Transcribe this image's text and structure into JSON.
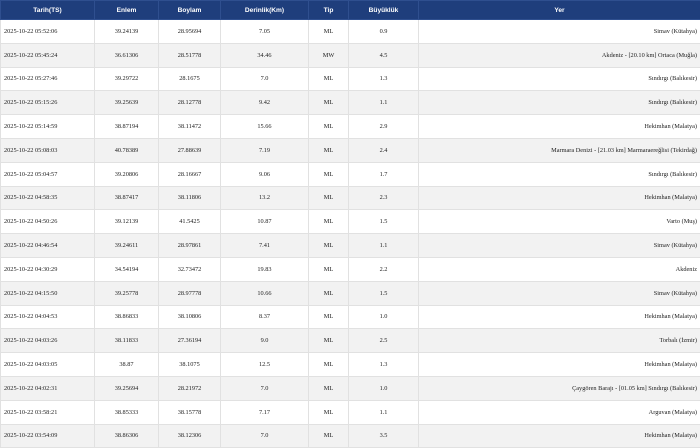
{
  "table": {
    "headers": [
      "Tarih(TS)",
      "Enlem",
      "Boylam",
      "Derinlik(Km)",
      "Tip",
      "Büyüklük",
      "Yer"
    ],
    "rows": [
      [
        "2025-10-22 05:52:06",
        "39.24139",
        "28.95694",
        "7.05",
        "ML",
        "0.9",
        "Simav (Kütahya)"
      ],
      [
        "2025-10-22 05:45:24",
        "36.61306",
        "28.51778",
        "34.46",
        "MW",
        "4.5",
        "Akdeniz - [20.10 km] Ortaca (Muğla)"
      ],
      [
        "2025-10-22 05:27:46",
        "39.29722",
        "28.1675",
        "7.0",
        "ML",
        "1.3",
        "Sındırgı (Balıkesir)"
      ],
      [
        "2025-10-22 05:15:26",
        "39.25639",
        "28.12778",
        "9.42",
        "ML",
        "1.1",
        "Sındırgı (Balıkesir)"
      ],
      [
        "2025-10-22 05:14:59",
        "38.87194",
        "38.11472",
        "15.66",
        "ML",
        "2.9",
        "Hekimhan (Malatya)"
      ],
      [
        "2025-10-22 05:08:03",
        "40.78389",
        "27.88639",
        "7.19",
        "ML",
        "2.4",
        "Marmara Denizi - [21.03 km] Marmaraereğlisi (Tekirdağ)"
      ],
      [
        "2025-10-22 05:04:57",
        "39.20806",
        "28.16667",
        "9.06",
        "ML",
        "1.7",
        "Sındırgı (Balıkesir)"
      ],
      [
        "2025-10-22 04:58:35",
        "38.87417",
        "38.11806",
        "13.2",
        "ML",
        "2.3",
        "Hekimhan (Malatya)"
      ],
      [
        "2025-10-22 04:50:26",
        "39.12139",
        "41.5425",
        "10.87",
        "ML",
        "1.5",
        "Varto (Muş)"
      ],
      [
        "2025-10-22 04:46:54",
        "39.24611",
        "28.97861",
        "7.41",
        "ML",
        "1.1",
        "Simav (Kütahya)"
      ],
      [
        "2025-10-22 04:30:29",
        "34.54194",
        "32.73472",
        "19.83",
        "ML",
        "2.2",
        "Akdeniz"
      ],
      [
        "2025-10-22 04:15:50",
        "39.25778",
        "28.97778",
        "10.66",
        "ML",
        "1.5",
        "Simav (Kütahya)"
      ],
      [
        "2025-10-22 04:04:53",
        "38.86833",
        "38.10806",
        "8.37",
        "ML",
        "1.0",
        "Hekimhan (Malatya)"
      ],
      [
        "2025-10-22 04:03:26",
        "38.11833",
        "27.36194",
        "9.0",
        "ML",
        "2.5",
        "Torbalı (İzmir)"
      ],
      [
        "2025-10-22 04:03:05",
        "38.87",
        "38.1075",
        "12.5",
        "ML",
        "1.3",
        "Hekimhan (Malatya)"
      ],
      [
        "2025-10-22 04:02:31",
        "39.25694",
        "28.21972",
        "7.0",
        "ML",
        "1.0",
        "Çaygören Barajı - [01.05 km] Sındırgı (Balıkesir)"
      ],
      [
        "2025-10-22 03:58:21",
        "38.85333",
        "38.15778",
        "7.17",
        "ML",
        "1.1",
        "Arguvan (Malatya)"
      ],
      [
        "2025-10-22 03:54:09",
        "38.86306",
        "38.12306",
        "7.0",
        "ML",
        "3.5",
        "Hekimhan (Malatya)"
      ]
    ]
  },
  "colors": {
    "header_bg": "#1f3e7c",
    "header_text": "#ffffff",
    "row_alt": "#f2f2f2",
    "border": "#e1e1e1"
  }
}
